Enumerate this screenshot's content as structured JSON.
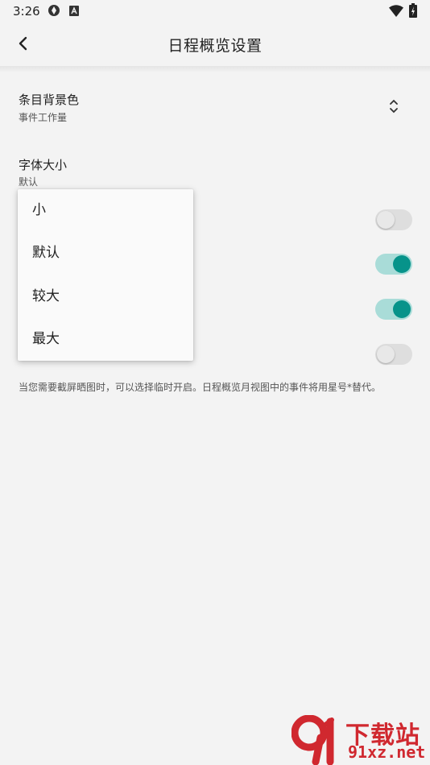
{
  "status_bar": {
    "time": "3:26",
    "icons": [
      "app-status-icon",
      "a-status-icon",
      "wifi-icon",
      "battery-icon"
    ]
  },
  "app_bar": {
    "title": "日程概览设置",
    "back_icon": "chevron-left-icon"
  },
  "settings": {
    "item_background": {
      "title": "条目背景色",
      "value": "事件工作量"
    },
    "font_size": {
      "title": "字体大小",
      "value": "默认"
    },
    "toggles": [
      {
        "state": "off"
      },
      {
        "state": "on"
      },
      {
        "state": "on"
      },
      {
        "state": "off"
      }
    ],
    "info_text": "当您需要截屏晒图时，可以选择临时开启。日程概览月视图中的事件将用星号*替代。"
  },
  "dropdown": {
    "options": [
      "小",
      "默认",
      "较大",
      "最大"
    ]
  },
  "watermark": {
    "brand": "下载站",
    "url": "91xz.net"
  },
  "colors": {
    "accent": "#07938a",
    "accent_track": "#a9dcd8",
    "background": "#f3f3f3",
    "watermark": "#d0282f"
  }
}
